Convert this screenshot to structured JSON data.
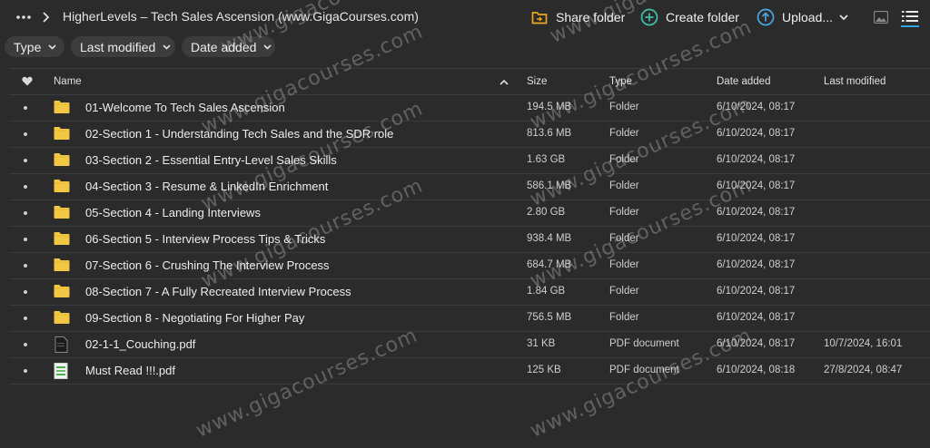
{
  "header": {
    "breadcrumb_title": "HigherLevels – Tech Sales Ascension (www.GigaCourses.com)",
    "actions": {
      "share": "Share folder",
      "create": "Create folder",
      "upload": "Upload..."
    }
  },
  "filters": {
    "type": "Type",
    "last_modified": "Last modified",
    "date_added": "Date added"
  },
  "table": {
    "columns": {
      "name": "Name",
      "size": "Size",
      "type": "Type",
      "date_added": "Date added",
      "last_modified": "Last modified"
    },
    "rows": [
      {
        "name": "01-Welcome To Tech Sales Ascension",
        "size": "194.5 MB",
        "type": "Folder",
        "added": "6/10/2024, 08:17",
        "modified": "",
        "icon": "folder-icon"
      },
      {
        "name": "02-Section 1 - Understanding Tech Sales and the SDR role",
        "size": "813.6 MB",
        "type": "Folder",
        "added": "6/10/2024, 08:17",
        "modified": "",
        "icon": "folder-icon"
      },
      {
        "name": "03-Section 2 - Essential Entry-Level Sales Skills",
        "size": "1.63 GB",
        "type": "Folder",
        "added": "6/10/2024, 08:17",
        "modified": "",
        "icon": "folder-icon"
      },
      {
        "name": "04-Section 3 - Resume & LinkedIn Enrichment",
        "size": "586.1 MB",
        "type": "Folder",
        "added": "6/10/2024, 08:17",
        "modified": "",
        "icon": "folder-icon"
      },
      {
        "name": "05-Section 4 - Landing Interviews",
        "size": "2.80 GB",
        "type": "Folder",
        "added": "6/10/2024, 08:17",
        "modified": "",
        "icon": "folder-icon"
      },
      {
        "name": "06-Section 5 - Interview Process Tips & Tricks",
        "size": "938.4 MB",
        "type": "Folder",
        "added": "6/10/2024, 08:17",
        "modified": "",
        "icon": "folder-icon"
      },
      {
        "name": "07-Section 6 - Crushing The Interview Process",
        "size": "684.7 MB",
        "type": "Folder",
        "added": "6/10/2024, 08:17",
        "modified": "",
        "icon": "folder-icon"
      },
      {
        "name": "08-Section 7 - A Fully Recreated Interview Process",
        "size": "1.84 GB",
        "type": "Folder",
        "added": "6/10/2024, 08:17",
        "modified": "",
        "icon": "folder-icon"
      },
      {
        "name": "09-Section 8 - Negotiating For Higher Pay",
        "size": "756.5 MB",
        "type": "Folder",
        "added": "6/10/2024, 08:17",
        "modified": "",
        "icon": "folder-icon"
      },
      {
        "name": "02-1-1_Couching.pdf",
        "size": "31 KB",
        "type": "PDF document",
        "added": "6/10/2024, 08:17",
        "modified": "10/7/2024, 16:01",
        "icon": "pdf-dark-file-icon"
      },
      {
        "name": "Must Read !!!.pdf",
        "size": "125 KB",
        "type": "PDF document",
        "added": "6/10/2024, 08:18",
        "modified": "27/8/2024, 08:47",
        "icon": "pdf-green-file-icon"
      }
    ]
  },
  "watermark": "www.gigacourses.com",
  "colors": {
    "background": "#2b2b2b",
    "folder": "#f2c744",
    "share_icon": "#f0a81e",
    "create_icon": "#3fc1a9",
    "upload_icon": "#4aa8e0",
    "view_active": "#2ba6de"
  }
}
